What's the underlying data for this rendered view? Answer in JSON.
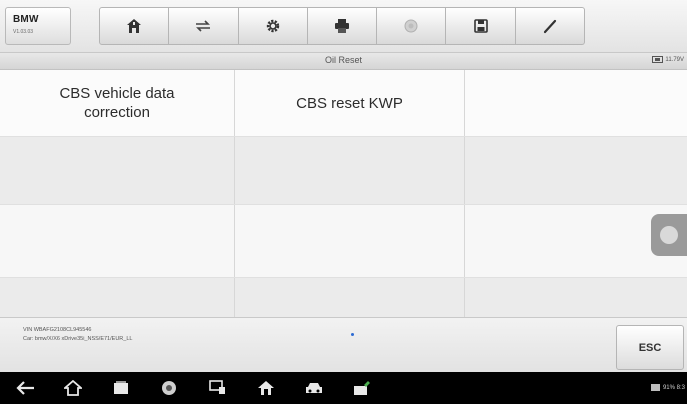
{
  "header": {
    "make": "BMW",
    "version": "V1.03.03",
    "toolbar": [
      {
        "icon": "home-icon"
      },
      {
        "icon": "vehicle-swap-icon"
      },
      {
        "icon": "gear-icon"
      },
      {
        "icon": "print-icon"
      },
      {
        "icon": "help-icon"
      },
      {
        "icon": "save-icon"
      },
      {
        "icon": "pen-icon"
      }
    ]
  },
  "titlebar": {
    "title": "Oil Reset",
    "voltage": "11.79V"
  },
  "grid": {
    "rows": [
      [
        "CBS vehicle data\ncorrection",
        "CBS reset KWP",
        ""
      ],
      [
        "",
        "",
        ""
      ],
      [
        "",
        "",
        ""
      ],
      [
        "",
        "",
        ""
      ]
    ]
  },
  "footer": {
    "vin_line": "VIN WBAFG2108CL945546",
    "car_line": "Car: bmw/X/X6 xDrive35i_NSS/E71/EUR_LL",
    "esc_label": "ESC"
  },
  "navbar": {
    "status_text": "91% 8:3"
  },
  "colors": {
    "accent": "#2d6bd3",
    "navbar": "#000000"
  }
}
